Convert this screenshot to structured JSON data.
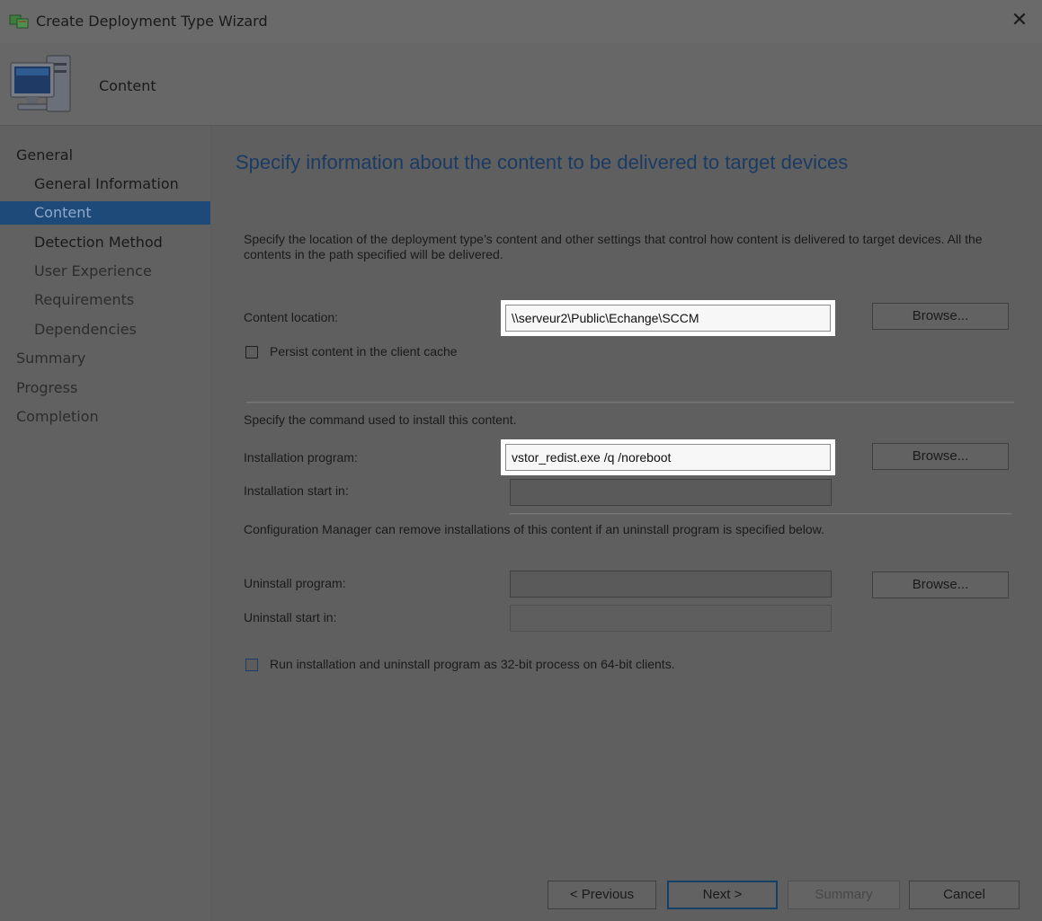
{
  "window": {
    "title": "Create Deployment Type Wizard",
    "close_glyph": "✕"
  },
  "banner": {
    "page_label": "Content",
    "icon": "computer-icon"
  },
  "nav": {
    "items": [
      {
        "label": "General",
        "state": "done"
      },
      {
        "label": "General Information",
        "state": "done"
      },
      {
        "label": "Content",
        "state": "active"
      },
      {
        "label": "Detection Method",
        "state": "done"
      },
      {
        "label": "User Experience",
        "state": "future"
      },
      {
        "label": "Requirements",
        "state": "future"
      },
      {
        "label": "Dependencies",
        "state": "future"
      },
      {
        "label": "Summary",
        "state": "future"
      },
      {
        "label": "Progress",
        "state": "future"
      },
      {
        "label": "Completion",
        "state": "future"
      }
    ]
  },
  "main": {
    "heading": "Specify information about the content to be delivered to target devices",
    "description": "Specify the location of the deployment type’s content and other settings that control how content is delivered to target devices. All the contents in the path specified will be delivered.",
    "content_location_label": "Content location:",
    "content_location_value": "\\\\serveur2\\Public\\Echange\\SCCM",
    "persist_label": "Persist content in the client cache",
    "install_section_label": "Specify the command used to install this content.",
    "installation_program_label": "Installation program:",
    "installation_program_value": "vstor_redist.exe /q /noreboot",
    "installation_start_label": "Installation start in:",
    "installation_start_value": "",
    "uninstall_note": "Configuration Manager can remove installations of this content if an uninstall program is specified below.",
    "uninstall_program_label": "Uninstall program:",
    "uninstall_program_value": "",
    "uninstall_start_label": "Uninstall start in:",
    "uninstall_start_value": "",
    "run32_label": "Run installation and uninstall program as 32-bit process on 64-bit clients.",
    "browse_label": "Browse..."
  },
  "footer": {
    "previous": "< Previous",
    "next": "Next >",
    "summary": "Summary",
    "cancel": "Cancel"
  },
  "colors": {
    "active_nav": "#1d4a78",
    "heading": "#1b3b63",
    "highlight": "#ffffff"
  }
}
